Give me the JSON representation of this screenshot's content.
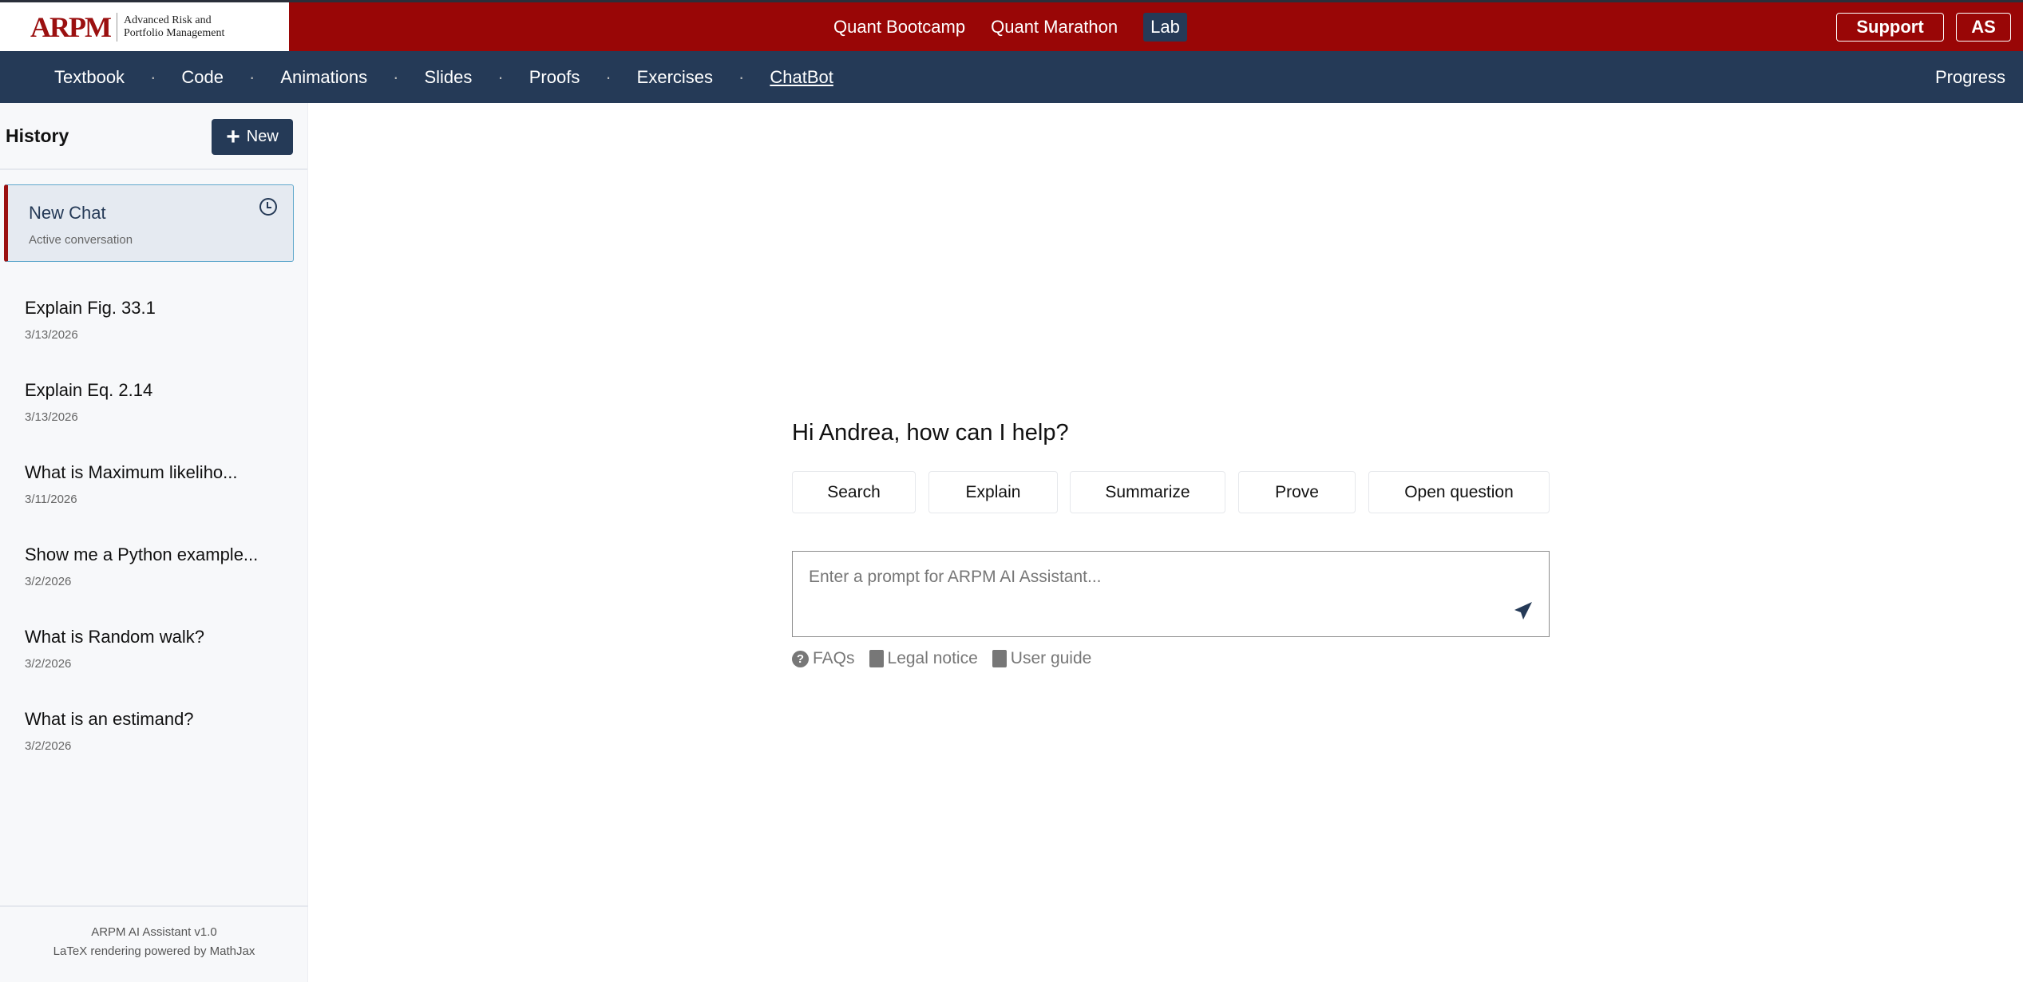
{
  "header": {
    "logo_text": "ARPM",
    "logo_subtitle_1": "Advanced Risk and",
    "logo_subtitle_2": "Portfolio Management",
    "links": [
      "Quant Bootcamp",
      "Quant Marathon",
      "Lab"
    ],
    "support": "Support",
    "user_initials": "AS"
  },
  "nav": {
    "items": [
      "Textbook",
      "Code",
      "Animations",
      "Slides",
      "Proofs",
      "Exercises",
      "ChatBot"
    ],
    "active": "ChatBot",
    "progress": "Progress"
  },
  "sidebar": {
    "title": "History",
    "new_label": "New",
    "active": {
      "title": "New Chat",
      "subtitle": "Active conversation"
    },
    "items": [
      {
        "title": "Explain Fig. 33.1",
        "date": "3/13/2026"
      },
      {
        "title": "Explain Eq. 2.14",
        "date": "3/13/2026"
      },
      {
        "title": "What is Maximum likeliho...",
        "date": "3/11/2026"
      },
      {
        "title": "Show me a Python example...",
        "date": "3/2/2026"
      },
      {
        "title": "What is Random walk?",
        "date": "3/2/2026"
      },
      {
        "title": "What is an estimand?",
        "date": "3/2/2026"
      }
    ],
    "footer_1": "ARPM AI Assistant v1.0",
    "footer_2": "LaTeX rendering powered by MathJax"
  },
  "main": {
    "greeting": "Hi Andrea, how can I help?",
    "quick": [
      "Search",
      "Explain",
      "Summarize",
      "Prove",
      "Open question"
    ],
    "prompt_placeholder": "Enter a prompt for ARPM AI Assistant...",
    "links": [
      "FAQs",
      "Legal notice",
      "User guide"
    ]
  },
  "colors": {
    "brand_red": "#990606",
    "navy": "#253a57"
  }
}
